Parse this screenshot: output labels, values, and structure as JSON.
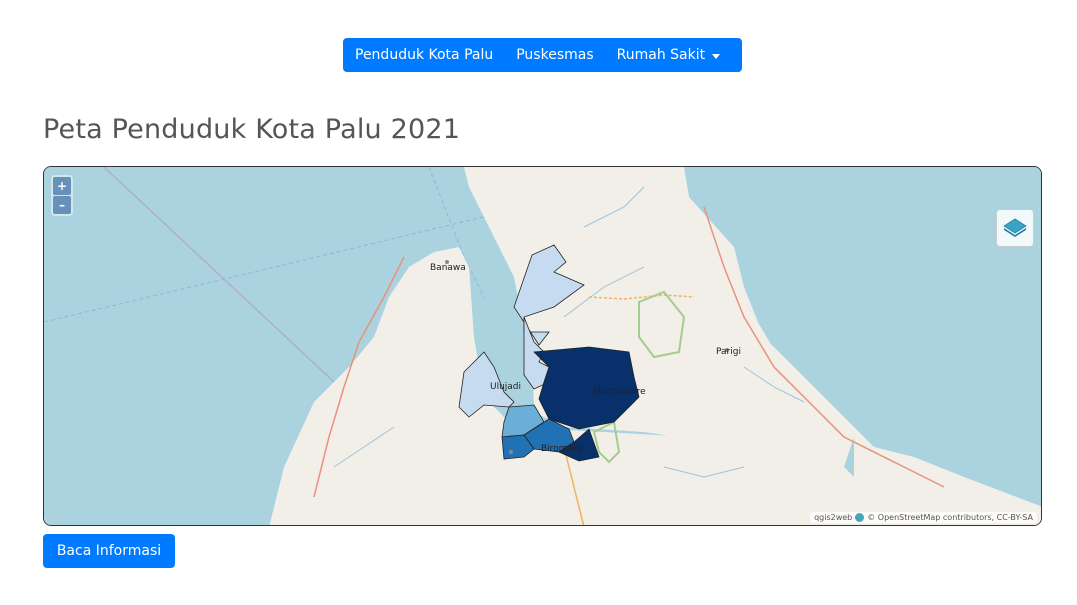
{
  "navbar": {
    "items": [
      {
        "label": "Penduduk Kota Palu"
      },
      {
        "label": "Puskesmas"
      },
      {
        "label": "Rumah Sakit",
        "dropdown": true
      }
    ],
    "color": "#007bff"
  },
  "page_title": "Peta Penduduk Kota Palu 2021",
  "map": {
    "zoom_in": "+",
    "zoom_out": "–",
    "labels": {
      "banawa": "Banawa",
      "parigi": "Parigi",
      "ulujadi": "Ulujadi",
      "mantikulore": "Mantikulore",
      "biromaru": "Biromaru"
    },
    "attribution": {
      "qgis": "qgis2web",
      "osm": "© OpenStreetMap contributors, CC-BY-SA"
    },
    "choropleth_colors": [
      "#c6dbef",
      "#6baed6",
      "#2171b5",
      "#08306b"
    ],
    "layer_switcher_icon": "layers-icon"
  },
  "read_button": "Baca Informasi"
}
